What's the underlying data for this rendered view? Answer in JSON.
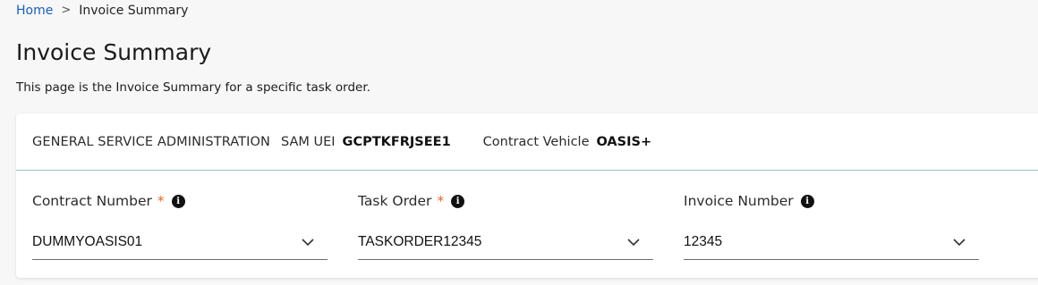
{
  "breadcrumb": {
    "home": "Home",
    "separator": ">",
    "current": "Invoice Summary"
  },
  "page": {
    "title": "Invoice Summary",
    "description": "This page is the Invoice Summary for a specific task order."
  },
  "header": {
    "agency": "GENERAL SERVICE ADMINISTRATION",
    "sam_uei_label": "SAM UEI",
    "sam_uei_value": "GCPTKFRJSEE1",
    "vehicle_label": "Contract Vehicle",
    "vehicle_value": "OASIS+"
  },
  "fields": {
    "contract_number": {
      "label": "Contract Number",
      "required": "*",
      "value": "DUMMYOASIS01"
    },
    "task_order": {
      "label": "Task Order",
      "required": "*",
      "value": "TASKORDER12345"
    },
    "invoice_number": {
      "label": "Invoice Number",
      "value": "12345"
    }
  },
  "icons": {
    "info": "i"
  },
  "colors": {
    "link": "#1a5fb4",
    "required": "#e06a2a",
    "divider": "#9bbfc0"
  }
}
